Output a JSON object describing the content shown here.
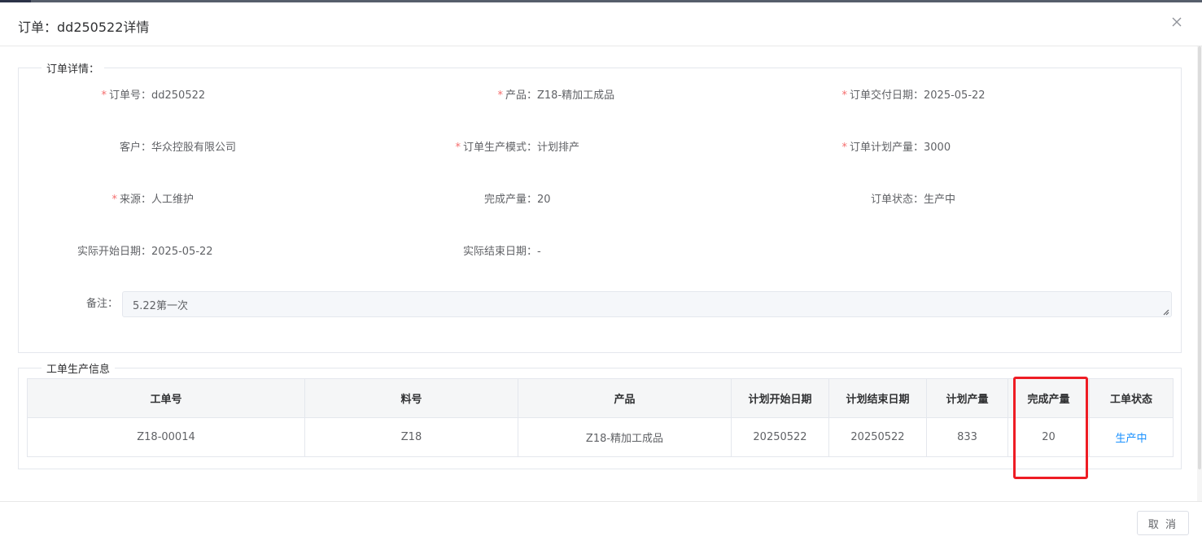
{
  "dialog": {
    "title": "订单：dd250522详情",
    "close_icon": "close-icon"
  },
  "order_section": {
    "legend": "订单详情：",
    "fields": {
      "order_no": {
        "label": "订单号：",
        "value": "dd250522",
        "required": true
      },
      "product": {
        "label": "产品：",
        "value": "Z18-精加工成品",
        "required": true
      },
      "delivery_date": {
        "label": "订单交付日期：",
        "value": "2025-05-22",
        "required": true
      },
      "customer": {
        "label": "客户：",
        "value": "华众控股有限公司",
        "required": false
      },
      "production_mode": {
        "label": "订单生产模式：",
        "value": "计划排产",
        "required": true
      },
      "planned_qty": {
        "label": "订单计划产量：",
        "value": "3000",
        "required": true
      },
      "source": {
        "label": "来源：",
        "value": "人工维护",
        "required": true
      },
      "completed_qty": {
        "label": "完成产量：",
        "value": "20",
        "required": false
      },
      "order_status": {
        "label": "订单状态：",
        "value": "生产中",
        "required": false
      },
      "actual_start": {
        "label": "实际开始日期：",
        "value": "2025-05-22",
        "required": false
      },
      "actual_end": {
        "label": "实际结束日期：",
        "value": "-",
        "required": false
      }
    },
    "remark": {
      "label": "备注：",
      "value": "5.22第一次"
    }
  },
  "workorder_section": {
    "legend": "工单生产信息",
    "columns": [
      "工单号",
      "料号",
      "产品",
      "计划开始日期",
      "计划结束日期",
      "计划产量",
      "完成产量",
      "工单状态"
    ],
    "rows": [
      [
        "Z18-00014",
        "Z18",
        "Z18-精加工成品",
        "20250522",
        "20250522",
        "833",
        "20",
        "生产中"
      ]
    ]
  },
  "footer": {
    "cancel_label": "取 消"
  },
  "colors": {
    "required_star": "#f56c6c",
    "status_link": "#1890ff",
    "highlight": "#ee1c24"
  }
}
